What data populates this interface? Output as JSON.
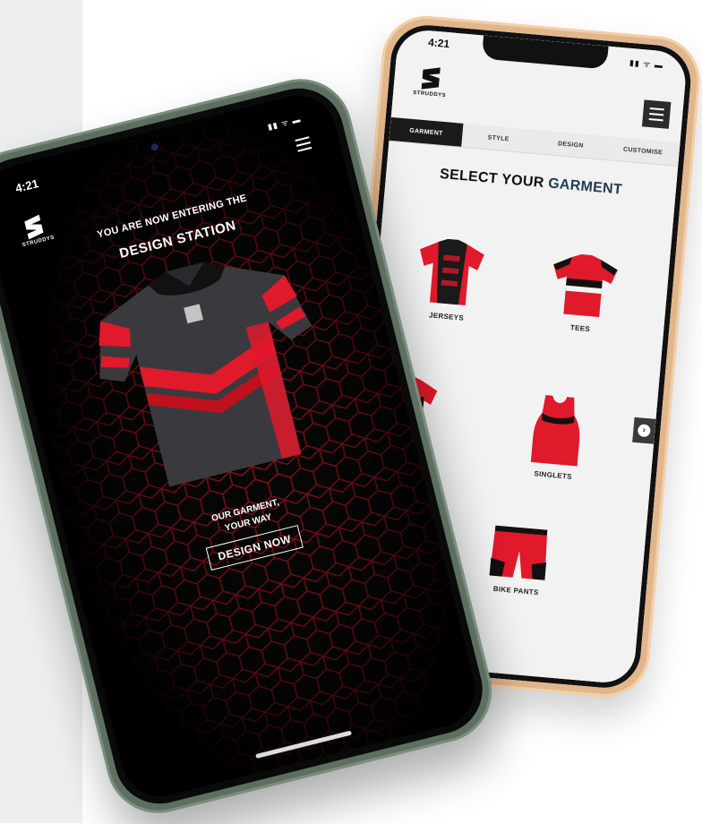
{
  "back_phone": {
    "time": "4:21",
    "status_icons": "▮▮ ᯤ ▬",
    "brand": "STRUDDYS",
    "tabs": [
      {
        "label": "GARMENT",
        "active": true
      },
      {
        "label": "STYLE",
        "active": false
      },
      {
        "label": "DESIGN",
        "active": false
      },
      {
        "label": "CUSTOMISE",
        "active": false
      }
    ],
    "title_main": "SELECT YOUR ",
    "title_accent": "GARMENT",
    "garments": [
      {
        "label": "JERSEYS"
      },
      {
        "label": "TEES"
      },
      {
        "label": ""
      },
      {
        "label": "SINGLETS"
      },
      {
        "label": "BIKE PANTS"
      }
    ]
  },
  "front_phone": {
    "time": "4:21",
    "status_icons": "▮▮ ᯤ ▬",
    "brand": "STRUDDYS",
    "entering_text": "YOU ARE NOW ENTERING THE",
    "station_text": "DESIGN STATION",
    "tagline_1": "OUR GARMENT,",
    "tagline_2": "YOUR WAY",
    "cta_label": "DESIGN NOW"
  },
  "colors": {
    "accent_red": "#e0192b",
    "dark": "#0a0a0a",
    "title_accent": "#1f3b57",
    "back_frame": "#e2b68c",
    "front_frame": "#5d6f61"
  }
}
